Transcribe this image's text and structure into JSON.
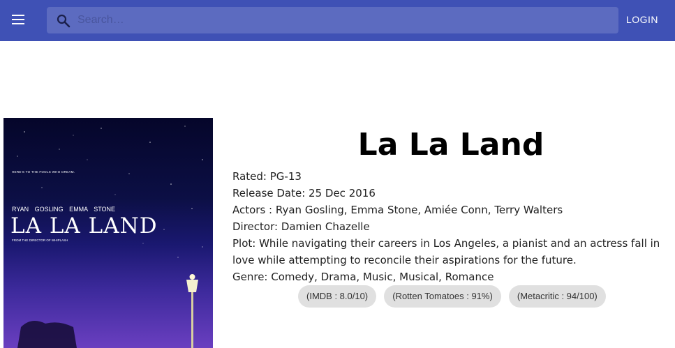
{
  "header": {
    "search_placeholder": "Search…",
    "login_label": "LOGIN",
    "colors": {
      "appbar": "#3f51b5",
      "search_bg": "#5c6bc0"
    }
  },
  "poster": {
    "tagline": "HERE'S TO THE FOOLS WHO DREAM.",
    "actors": "RYAN GOSLING EMMA STONE",
    "title": "LA LA LAND",
    "credit": "FROM THE DIRECTOR OF WHIPLASH"
  },
  "movie": {
    "title": "La La Land",
    "rated": "Rated: PG-13",
    "release_date": "Release Date: 25 Dec 2016",
    "actors": "Actors : Ryan Gosling, Emma Stone, Amiée Conn, Terry Walters",
    "director": "Director: Damien Chazelle",
    "plot": "Plot: While navigating their careers in Los Angeles, a pianist and an actress fall in love while attempting to reconcile their aspirations for the future.",
    "genre": "Genre: Comedy, Drama, Music, Musical, Romance"
  },
  "ratings": [
    {
      "label": "(IMDB : 8.0/10)"
    },
    {
      "label": "(Rotten Tomatoes : 91%)"
    },
    {
      "label": "(Metacritic : 94/100)"
    }
  ]
}
